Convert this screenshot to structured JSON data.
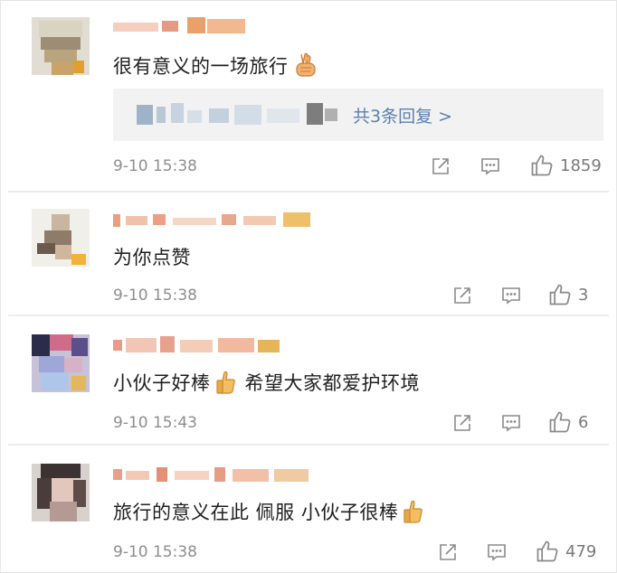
{
  "comments": [
    {
      "text": "很有意义的一场旅行",
      "emoji": "victory-hand",
      "reply_link": "共3条回复 >",
      "time": "9-10 15:38",
      "likes": "1859"
    },
    {
      "text": "为你点赞",
      "time": "9-10 15:38",
      "likes": "3"
    },
    {
      "text": "小伙子好棒",
      "emoji": "thumbs-up",
      "text_after": "希望大家都爱护环境",
      "time": "9-10 15:43",
      "likes": "6"
    },
    {
      "text": "旅行的意义在此 佩服 小伙子很棒",
      "emoji": "thumbs-up",
      "time": "9-10 15:38",
      "likes": "479"
    }
  ],
  "icons": {
    "share": "share-icon",
    "reply": "comment-icon",
    "like": "thumbs-up-icon"
  },
  "colors": {
    "link": "#5b7fb0",
    "meta": "#8e8e8e",
    "text": "#1f1f1f",
    "reply_bg": "#f2f2f2"
  }
}
